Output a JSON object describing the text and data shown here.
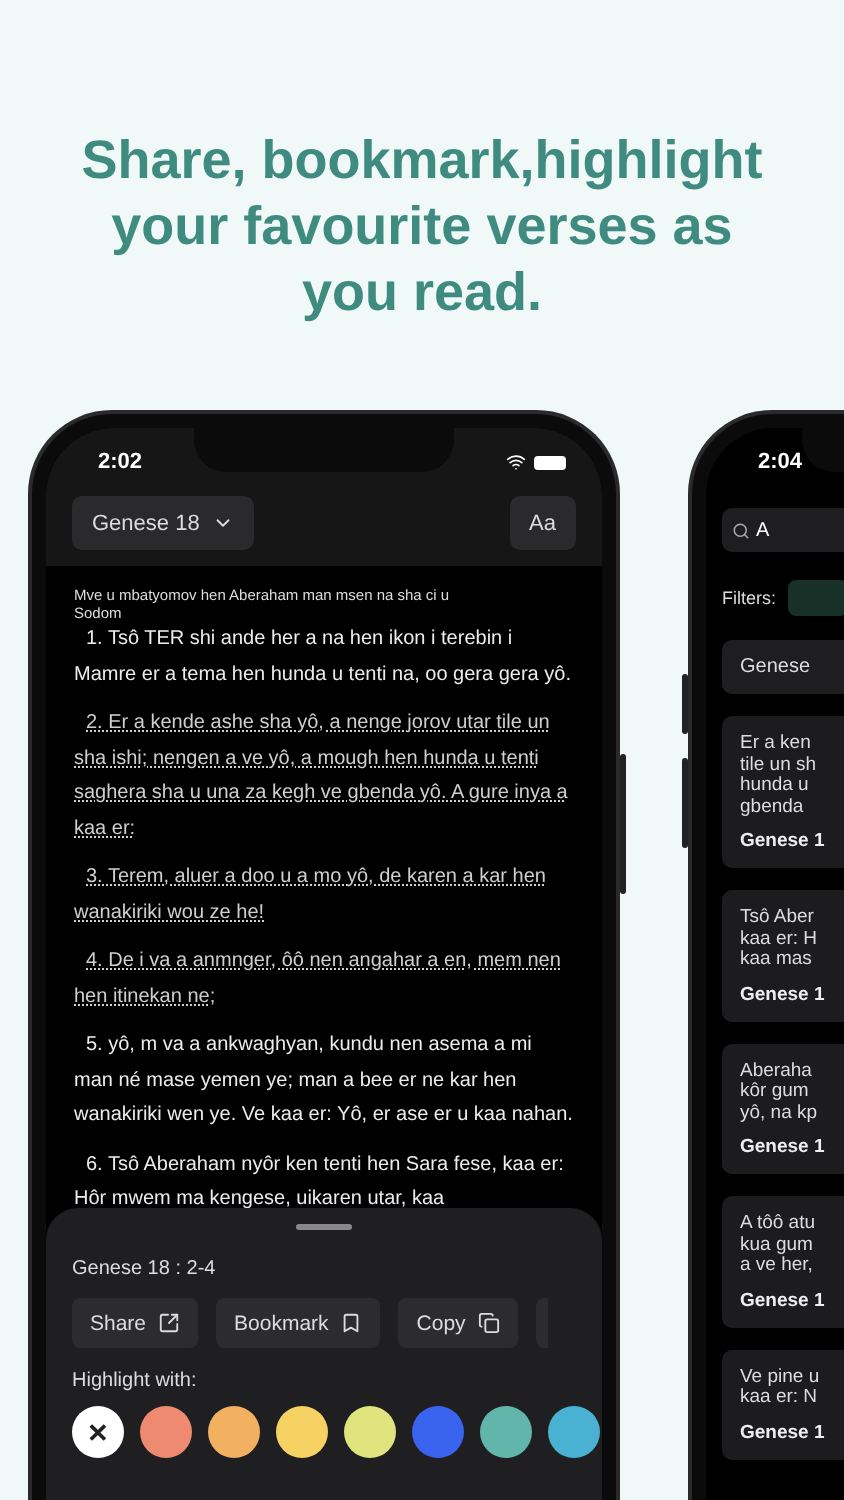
{
  "headline": "Share, bookmark,highlight your favourite verses as you read.",
  "reader": {
    "time": "2:02",
    "chapter_button": "Genese 18",
    "font_button": "Aa",
    "section_heading": "Mve u mbatyomov hen Aberaham man msen na sha ci u Sodom",
    "verses": [
      {
        "text": "1. Tsô TER shi ande her a na hen ikon i terebin i Mamre er a tema hen hunda u tenti na, oo gera gera yô.",
        "selected": false
      },
      {
        "text": "2. Er a kende ashe sha yô, a nenge jorov utar tile un sha ishi; nengen a ve yô, a mough hen hunda u tenti saghera sha u una za kegh ve gbenda yô. A gure inya a kaa er:",
        "selected": true
      },
      {
        "text": "3. Terem, aluer a doo u a mo yô, de karen a kar hen wanakiriki wou ze he!",
        "selected": true
      },
      {
        "text": "4. De i va a anmnger, ôô nen angahar a en, mem nen hen itinekan ne;",
        "selected": true
      },
      {
        "text": "5. yô, m va a ankwaghyan, kundu nen asema a mi man né mase yemen ye; man a bee er ne kar hen wanakiriki wen ye. Ve kaa er: Yô, er ase er u kaa nahan.",
        "selected": false
      },
      {
        "text": "6. Tsô Aberaham nyôr ken tenti hen Sara fese, kaa er: Hôr mwem ma kengese, uikaren utar, kaa",
        "selected": false
      }
    ],
    "sheet": {
      "reference": "Genese 18 : 2-4",
      "actions": [
        {
          "label": "Share",
          "kind": "share"
        },
        {
          "label": "Bookmark",
          "kind": "bookmark"
        },
        {
          "label": "Copy",
          "kind": "copy"
        }
      ],
      "highlight_label": "Highlight with:",
      "swatches": [
        {
          "kind": "clear",
          "label": "✕"
        },
        {
          "kind": "color",
          "color": "#ee8a70"
        },
        {
          "kind": "color",
          "color": "#f2b061"
        },
        {
          "kind": "color",
          "color": "#f6d163"
        },
        {
          "kind": "color",
          "color": "#dfe57c"
        },
        {
          "kind": "color",
          "color": "#3a63ef"
        },
        {
          "kind": "color",
          "color": "#62b5ab"
        },
        {
          "kind": "color",
          "color": "#49b2d2"
        }
      ]
    }
  },
  "search": {
    "time": "2:04",
    "value": "A",
    "filters_label": "Filters:",
    "book": "Genese",
    "results": [
      {
        "lines": [
          "Er a ken",
          "tile un sh",
          "hunda u",
          "gbenda"
        ],
        "reference": "Genese 1"
      },
      {
        "lines": [
          "Tsô Aber",
          "kaa er: H",
          "kaa mas"
        ],
        "reference": "Genese 1"
      },
      {
        "lines": [
          "Aberaha",
          "kôr gum",
          "yô, na kp"
        ],
        "reference": "Genese 1"
      },
      {
        "lines": [
          "A tôô atu",
          "kua gum",
          "a ve her,"
        ],
        "reference": "Genese 1"
      },
      {
        "lines": [
          "Ve pine u",
          "kaa er: N"
        ],
        "reference": "Genese 1"
      }
    ]
  }
}
